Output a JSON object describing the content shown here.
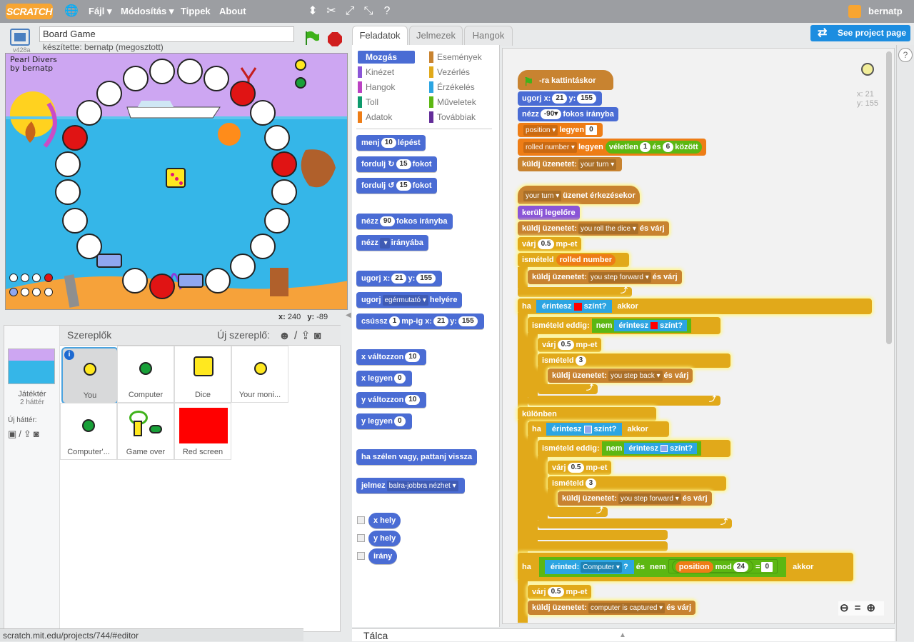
{
  "app": {
    "logo": "SCRATCH",
    "version": "v428a"
  },
  "menu": {
    "file": "Fájl ▾",
    "edit": "Módosítás ▾",
    "tips": "Tippek",
    "about": "About"
  },
  "user": {
    "name": "bernatp"
  },
  "project": {
    "title": "Board Game",
    "byline": "készítette: bernatp (megosztott)",
    "see_page": "See project page"
  },
  "stage": {
    "text_line1": "Pearl Divers",
    "text_line2": "by bernatp",
    "x_label": "x:",
    "x": "240",
    "y_label": "y:",
    "y": "-89"
  },
  "sprites_pane": {
    "title": "Szereplők",
    "new_sprite": "Új szereplő:",
    "stage_label": "Játéktér",
    "backdrops": "2 háttér",
    "new_backdrop": "Új háttér:",
    "sprites": [
      "You",
      "Computer",
      "Dice",
      "Your moni...",
      "Computer'...",
      "Game over",
      "Red screen"
    ]
  },
  "tabs": [
    "Feladatok",
    "Jelmezek",
    "Hangok"
  ],
  "categories": [
    {
      "label": "Mozgás",
      "color": "#4a6cd4"
    },
    {
      "label": "Események",
      "color": "#c88330"
    },
    {
      "label": "Kinézet",
      "color": "#8a55d7"
    },
    {
      "label": "Vezérlés",
      "color": "#e1a91a"
    },
    {
      "label": "Hangok",
      "color": "#bb42c3"
    },
    {
      "label": "Érzékelés",
      "color": "#2ca5e2"
    },
    {
      "label": "Toll",
      "color": "#0e9a6c"
    },
    {
      "label": "Műveletek",
      "color": "#5cb712"
    },
    {
      "label": "Adatok",
      "color": "#ee7d16"
    },
    {
      "label": "Továbbiak",
      "color": "#632d99"
    }
  ],
  "palette": {
    "move": "menj",
    "move_n": "10",
    "move_suffix": "lépést",
    "turn": "fordulj",
    "turn_cw_n": "15",
    "turn_ccw_n": "15",
    "turn_suffix": "fokot",
    "point": "nézz",
    "point_n": "90",
    "point_suffix": "fokos irányba",
    "point_towards": "nézz",
    "point_towards_suffix": "irányába",
    "goto": "ugorj",
    "goto_x_label": "x:",
    "goto_x": "21",
    "goto_y_label": "y:",
    "goto_y": "155",
    "goto_mouse": "ugorj",
    "goto_mouse_dd": "egérmutató",
    "goto_mouse_suffix": "helyére",
    "glide": "csússz",
    "glide_n": "1",
    "glide_mid": "mp-ig",
    "glide_x_label": "x:",
    "glide_x": "21",
    "glide_y_label": "y:",
    "glide_y": "155",
    "change_x": "x változzon",
    "change_x_n": "10",
    "set_x": "x legyen",
    "set_x_n": "0",
    "change_y": "y változzon",
    "change_y_n": "10",
    "set_y": "y legyen",
    "set_y_n": "0",
    "bounce": "ha szélen vagy, pattanj vissza",
    "rotstyle": "jelmez",
    "rotstyle_dd": "balra-jobbra nézhet",
    "rep_x": "x hely",
    "rep_y": "y hely",
    "rep_dir": "irány"
  },
  "script": {
    "s1_hat": "-ra kattintáskor",
    "s1_goto": "ugorj",
    "s1_goto_x_label": "x:",
    "s1_goto_x": "21",
    "s1_goto_y_label": "y:",
    "s1_goto_y": "155",
    "s1_point": "nézz",
    "s1_point_n": "-90",
    "s1_point_suffix": "fokos irányba",
    "s1_set_pos_dd": "position",
    "s1_set_pos": "legyen",
    "s1_set_pos_n": "0",
    "s1_set_roll_dd": "rolled number",
    "s1_set_roll": "legyen",
    "s1_rand": "véletlen",
    "s1_rand_a": "1",
    "s1_rand_mid": "és",
    "s1_rand_b": "6",
    "s1_rand_suffix": "között",
    "s1_bcast": "küldj üzenetet:",
    "s1_bcast_dd": "your turn",
    "s2_hat_dd": "your turn",
    "s2_hat": "üzenet érkezésekor",
    "s2_front": "kerülj legelőre",
    "s2_bw1": "küldj üzenetet:",
    "s2_bw1_dd": "you roll the dice",
    "s2_bw1_suffix": "és várj",
    "s2_wait1": "várj",
    "s2_wait1_n": "0.5",
    "s2_wait1_suffix": "mp-et",
    "s2_repeat": "ismételd",
    "s2_repeat_var": "rolled number",
    "s2_bw2": "küldj üzenetet:",
    "s2_bw2_dd": "you step forward",
    "s2_bw2_suffix": "és várj",
    "s2_if1": "ha",
    "s2_if1_sense": "érintesz",
    "s2_if1_sense_suffix": "színt?",
    "s2_if1_then": "akkor",
    "s2_until1": "ismételd eddig:",
    "s2_until1_not": "nem",
    "s2_until1_sense": "érintesz",
    "s2_until1_suffix": "színt?",
    "s2_wait2": "várj",
    "s2_wait2_n": "0.5",
    "s2_wait2_suffix": "mp-et",
    "s2_rep3": "ismételd",
    "s2_rep3_n": "3",
    "s2_bw3": "küldj üzenetet:",
    "s2_bw3_dd": "you step back",
    "s2_bw3_suffix": "és várj",
    "s2_else": "különben",
    "s2_if2": "ha",
    "s2_if2_sense": "érintesz",
    "s2_if2_suffix": "színt?",
    "s2_if2_then": "akkor",
    "s2_until2": "ismételd eddig:",
    "s2_until2_not": "nem",
    "s2_until2_sense": "érintesz",
    "s2_until2_suffix": "színt?",
    "s2_wait3": "várj",
    "s2_wait3_n": "0.5",
    "s2_wait3_suffix": "mp-et",
    "s2_rep4": "ismételd",
    "s2_rep4_n": "3",
    "s2_bw4": "küldj üzenetet:",
    "s2_bw4_dd": "you step forward",
    "s2_bw4_suffix": "és várj",
    "s2_if3": "ha",
    "s2_if3_sense": "érinted:",
    "s2_if3_dd": "Computer",
    "s2_if3_q": "?",
    "s2_if3_and": "és",
    "s2_if3_not": "nem",
    "s2_if3_pos": "position",
    "s2_if3_mod": "mod",
    "s2_if3_mod_n": "24",
    "s2_if3_eq": "=",
    "s2_if3_eq_n": "0",
    "s2_if3_then": "akkor",
    "s2_wait4": "várj",
    "s2_wait4_n": "0.5",
    "s2_wait4_suffix": "mp-et",
    "s2_bw5": "küldj üzenetet:",
    "s2_bw5_dd": "computer is captured",
    "s2_bw5_suffix": "és várj"
  },
  "sprite_info": {
    "x_label": "x:",
    "x": "21",
    "y_label": "y:",
    "y": "155"
  },
  "bottom": {
    "talca": "Tálca",
    "status_url": "scratch.mit.edu/projects/744/#editor"
  }
}
